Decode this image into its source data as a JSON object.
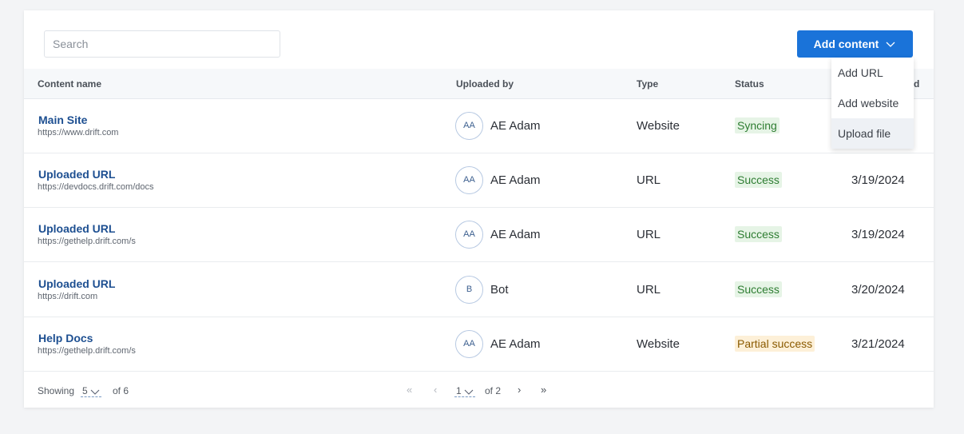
{
  "search": {
    "placeholder": "Search"
  },
  "add_button": {
    "label": "Add content"
  },
  "menu": {
    "items": [
      "Add URL",
      "Add website",
      "Upload file"
    ]
  },
  "table": {
    "headers": [
      "Content name",
      "Uploaded by",
      "Type",
      "Status",
      "d"
    ],
    "rows": [
      {
        "name": "Main Site",
        "url": "https://www.drift.com",
        "initials": "AA",
        "uploader": "AE Adam",
        "type": "Website",
        "status": "Syncing",
        "date": ""
      },
      {
        "name": "Uploaded URL",
        "url": "https://devdocs.drift.com/docs",
        "initials": "AA",
        "uploader": "AE Adam",
        "type": "URL",
        "status": "Success",
        "date": "3/19/2024"
      },
      {
        "name": "Uploaded URL",
        "url": "https://gethelp.drift.com/s",
        "initials": "AA",
        "uploader": "AE Adam",
        "type": "URL",
        "status": "Success",
        "date": "3/19/2024"
      },
      {
        "name": "Uploaded URL",
        "url": "https://drift.com",
        "initials": "B",
        "uploader": "Bot",
        "type": "URL",
        "status": "Success",
        "date": "3/20/2024"
      },
      {
        "name": "Help Docs",
        "url": "https://gethelp.drift.com/s",
        "initials": "AA",
        "uploader": "AE Adam",
        "type": "Website",
        "status": "Partial success",
        "date": "3/21/2024"
      }
    ]
  },
  "footer": {
    "showing_label": "Showing",
    "page_size": "5",
    "of_total": "of 6",
    "current_page": "1",
    "of_pages": "of 2"
  },
  "colors": {
    "accent": "#1a73d9",
    "link": "#1d4f91",
    "success_bg": "#e6f4e6",
    "partial_bg": "#fdf0d8"
  },
  "icons": {
    "add_button_chevron": "chevron-down-icon",
    "first_page": "double-chevron-left-icon",
    "prev_page": "chevron-left-icon",
    "next_page": "chevron-right-icon",
    "last_page": "double-chevron-right-icon"
  }
}
